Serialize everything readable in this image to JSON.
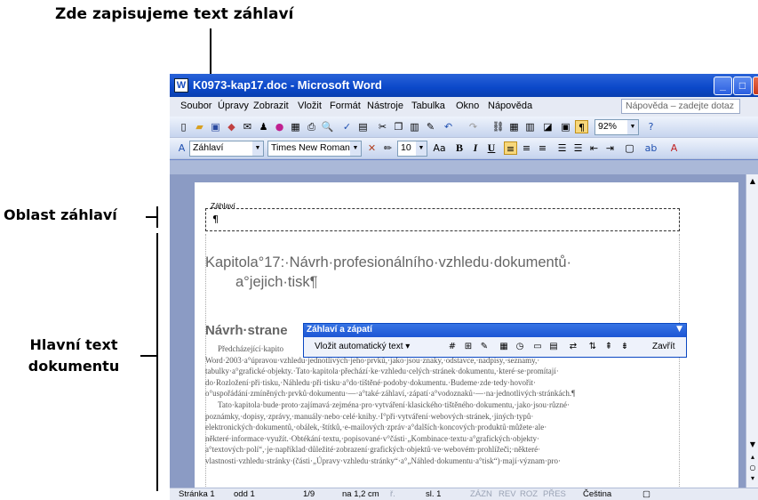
{
  "annotations": {
    "header_text_label": "Zde zapisujeme text záhlaví",
    "header_area_label": "Oblast záhlaví",
    "main_text_label_line1": "Hlavní text",
    "main_text_label_line2": "dokumentu"
  },
  "window": {
    "title": "K0973-kap17.doc - Microsoft Word",
    "minimize": "_",
    "maximize": "□",
    "close": "✕"
  },
  "menubar": {
    "items": [
      "Soubor",
      "Úpravy",
      "Zobrazit",
      "Vložit",
      "Formát",
      "Nástroje",
      "Tabulka",
      "Okno",
      "Nápověda"
    ],
    "help_placeholder": "Nápověda – zadejte dotaz"
  },
  "toolbar": {
    "zoom": "92%",
    "style": "Záhlaví",
    "font": "Times New Roman",
    "size": "10",
    "bold": "B",
    "italic": "I",
    "underline": "U"
  },
  "page": {
    "header_label": "Záhlaví",
    "pilcrow": "¶",
    "heading1_line1": "Kapitola°17:·Návrh·profesionálního·vzhledu·dokumentů·",
    "heading1_line2": "a°jejich·tisk¶",
    "heading2": "Návrh·strane",
    "body": [
      "Předcházející·kapito",
      "Word·2003·a°úpravou·vzhledu·jednotlivých·jeho·prvků,·jako·jsou·znaky,·odstavce,·nadpisy,·seznamy,·",
      "tabulky·a°grafické·objekty.·Tato·kapitola·přechází·ke·vzhledu·celých·stránek·dokumentu,·které·se·promítají·",
      "do·Rozložení·při·tisku,·Náhledu·při·tisku·a°do·tištěné·podoby·dokumentu.·Budeme·zde·tedy·hovořit·",
      "o°uspořádání·zmíněných·prvků·dokumentu·—·a°také·záhlaví,·zápatí·a°vodoznaků·—·na·jednotlivých·stránkách.¶",
      "Tato·kapitola·bude·proto·zajímavá·zejména·pro·vytváření·klasického·tištěného·dokumentu,·jako·jsou·různé·",
      "poznámky,·dopisy,·zprávy,·manuály·nebo·celé·knihy.·I°při·vytváření·webových·stránek,·jiných·typů·",
      "elektronických·dokumentů,·obálek,·štítků,·e-mailových·zpráv·a°dalších·koncových·produktů·můžete·ale·",
      "některé·informace·využít.·Obtékání·textu,·popisované·v°části·„Kombinace·textu·a°grafických·objekty·",
      "a°textových·polí“,·je·například·důležité·zobrazení·grafických·objektů·ve·webovém·prohlížeči;·některé·",
      "vlastnosti·vzhledu·stránky·(části·„Úpravy·vzhledu·stránky“·a°„Náhled·dokumentu·a°tisk“)·mají·význam·pro·"
    ]
  },
  "hf_toolbar": {
    "title": "Záhlaví a zápatí",
    "insert_autotext": "Vložit automatický text ▾",
    "close": "Zavřít"
  },
  "statusbar": {
    "page": "Stránka 1",
    "section": "odd 1",
    "pages": "1/9",
    "at": "na 1,2 cm",
    "line": "ř.",
    "column": "sl. 1",
    "rec": "ZÁZN",
    "trk": "REV",
    "ext": "ROZ",
    "ovr": "PŘES",
    "language": "Čeština"
  }
}
